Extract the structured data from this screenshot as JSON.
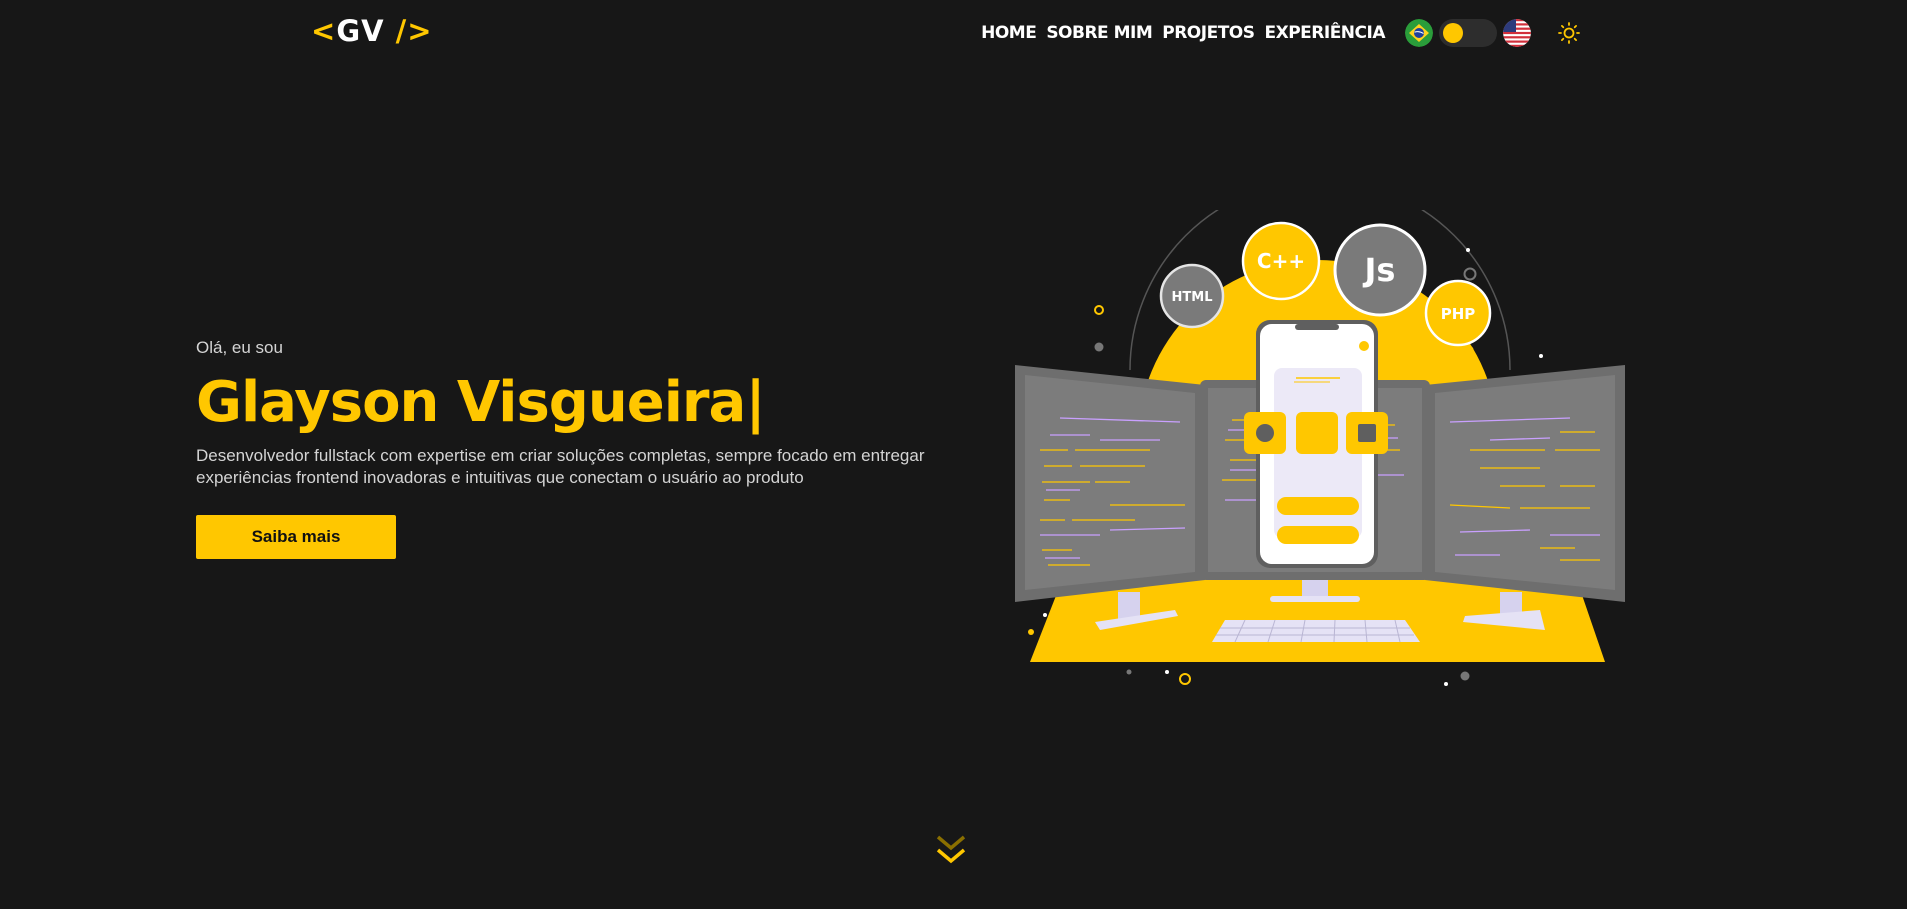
{
  "logo": {
    "open": "<",
    "initials": "GV",
    "close": "/>"
  },
  "nav": {
    "items": [
      {
        "label": "HOME"
      },
      {
        "label": "SOBRE MIM"
      },
      {
        "label": "PROJETOS"
      },
      {
        "label": "EXPERIÊNCIA"
      }
    ],
    "language_flags": [
      "brazil-flag-icon",
      "usa-flag-icon"
    ],
    "theme_icon": "sun-icon"
  },
  "hero": {
    "greeting": "Olá, eu sou",
    "name": "Glayson Visgueira|",
    "description": "Desenvolvedor fullstack com expertise em criar soluções completas, sempre focado em entregar experiências frontend inovadoras e intuitivas que conectam o usuário ao produto",
    "cta_label": "Saiba mais"
  },
  "illustration": {
    "badges": [
      "HTML",
      "C++",
      "Js",
      "PHP"
    ]
  },
  "colors": {
    "accent": "#ffc700",
    "background": "#171717",
    "panel": "#7a7a7a"
  },
  "scroll_icon": "double-chevron-down-icon"
}
